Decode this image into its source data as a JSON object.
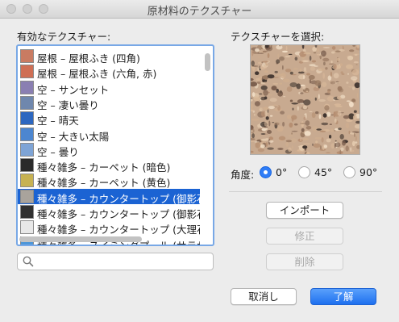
{
  "window": {
    "title": "原材料のテクスチャー"
  },
  "left": {
    "heading": "有効なテクスチャー:",
    "items": [
      {
        "label": "屋根 – 屋根ふき (四角)",
        "swatch": "#c97b62"
      },
      {
        "label": "屋根 – 屋根ふき (六角, 赤)",
        "swatch": "#cf6f55"
      },
      {
        "label": "空 – サンセット",
        "swatch": "#8a7fb2"
      },
      {
        "label": "空 – 凄い曇り",
        "swatch": "#6f87ad"
      },
      {
        "label": "空 – 晴天",
        "swatch": "#2d67c0"
      },
      {
        "label": "空 – 大きい太陽",
        "swatch": "#4c86d0"
      },
      {
        "label": "空 – 曇り",
        "swatch": "#7ea4d6"
      },
      {
        "label": "種々雑多 – カーペット (暗色)",
        "swatch": "#2a2a2a"
      },
      {
        "label": "種々雑多 – カーペット (黄色)",
        "swatch": "#c7b252"
      },
      {
        "label": "種々雑多 – カウンタートップ (御影石)",
        "swatch": "#a9a39c",
        "selected": true
      },
      {
        "label": "種々雑多 – カウンタートップ (御影石)",
        "swatch": "#303030"
      },
      {
        "label": "種々雑多 – カウンタートップ (大理石)",
        "swatch": "#e8e8e8"
      },
      {
        "label": "種々雑多 – スイミングプール (サラサラ)",
        "swatch": "#4d96d8"
      }
    ],
    "search_placeholder": ""
  },
  "right": {
    "heading": "テクスチャーを選択:",
    "angle_label": "角度:",
    "angles": [
      {
        "label": "0°",
        "selected": true
      },
      {
        "label": "45°",
        "selected": false
      },
      {
        "label": "90°",
        "selected": false
      }
    ],
    "import_label": "インポート",
    "edit_label": "修正",
    "delete_label": "削除"
  },
  "footer": {
    "cancel_label": "取消し",
    "ok_label": "了解"
  },
  "colors": {
    "accent": "#1b63d3",
    "default_button": "#1e70ef"
  }
}
